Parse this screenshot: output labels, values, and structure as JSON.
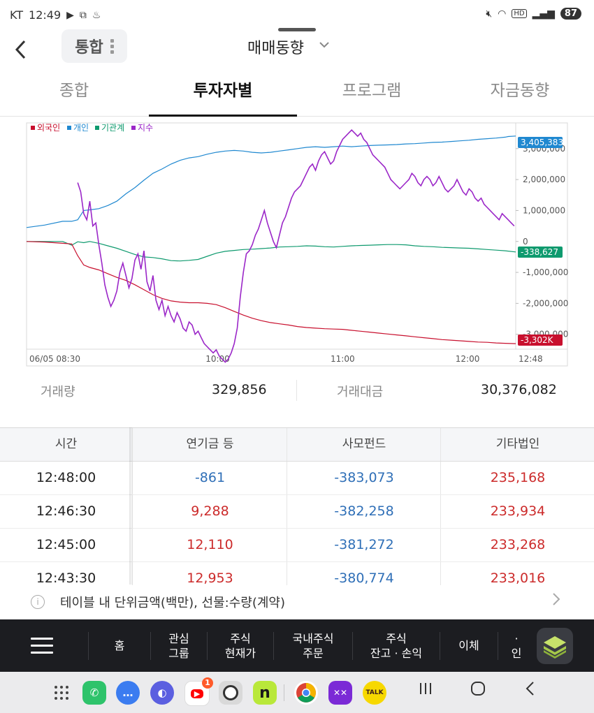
{
  "status_bar": {
    "carrier": "KT",
    "time": "12:49",
    "battery": "87"
  },
  "app_bar": {
    "pill_label": "통합",
    "title": "매매동향"
  },
  "tabs": [
    {
      "label": "종합",
      "active": false
    },
    {
      "label": "투자자별",
      "active": true
    },
    {
      "label": "프로그램",
      "active": false
    },
    {
      "label": "자금동향",
      "active": false
    }
  ],
  "chart_data": {
    "type": "line",
    "legend": [
      "외국인",
      "개인",
      "기관계",
      "지수"
    ],
    "colors": {
      "foreign": "#c8102e",
      "individual": "#1f88d0",
      "institution": "#0e9a6e",
      "index": "#9b27c8"
    },
    "y_tick_labels": [
      "3,000,000",
      "2,000,000",
      "1,000,000",
      "0",
      "-1,000,000",
      "-2,000,000",
      "-3,000,000"
    ],
    "y_ticks": [
      3000000,
      2000000,
      1000000,
      0,
      -1000000,
      -2000000,
      -3000000
    ],
    "x_tick_labels": [
      "06/05 08:30",
      "10:00",
      "11:00",
      "12:00",
      "12:48"
    ],
    "ylim": [
      -3480000,
      3830000
    ],
    "end_labels": {
      "individual": "3,405,383",
      "institution": "-338,627",
      "foreign": "-3,302K"
    },
    "series": [
      {
        "name": "개인",
        "key": "individual",
        "x": [
          0,
          12,
          24,
          30,
          34,
          38,
          42,
          48,
          54,
          60,
          66,
          72,
          78,
          84,
          90,
          96,
          102,
          108,
          114,
          120,
          126,
          132,
          138,
          144,
          150,
          156,
          162,
          168,
          174,
          180,
          186,
          192,
          198,
          204,
          210,
          216,
          222,
          228,
          234,
          240,
          246,
          252,
          258,
          264,
          270,
          276,
          282,
          288,
          294,
          300,
          306,
          312,
          318,
          320,
          325
        ],
        "y": [
          450000,
          530000,
          650000,
          650000,
          700000,
          1000000,
          1020000,
          1060000,
          1160000,
          1300000,
          1540000,
          1740000,
          1980000,
          2200000,
          2340000,
          2500000,
          2620000,
          2700000,
          2740000,
          2820000,
          2880000,
          2920000,
          2940000,
          2920000,
          2880000,
          2860000,
          2880000,
          2920000,
          2960000,
          3000000,
          3040000,
          3060000,
          3040000,
          3060000,
          3080000,
          3060000,
          3080000,
          3100000,
          3110000,
          3120000,
          3130000,
          3150000,
          3160000,
          3180000,
          3200000,
          3210000,
          3230000,
          3250000,
          3270000,
          3300000,
          3320000,
          3340000,
          3370000,
          3390000,
          3405383
        ]
      },
      {
        "name": "기관계",
        "key": "institution",
        "x": [
          0,
          12,
          24,
          30,
          34,
          38,
          42,
          48,
          54,
          60,
          66,
          72,
          78,
          84,
          90,
          96,
          102,
          108,
          114,
          120,
          126,
          132,
          138,
          144,
          150,
          156,
          162,
          168,
          174,
          180,
          186,
          192,
          198,
          204,
          210,
          216,
          222,
          228,
          234,
          240,
          246,
          252,
          258,
          264,
          270,
          276,
          282,
          288,
          294,
          300,
          306,
          312,
          318,
          325
        ],
        "y": [
          0,
          0,
          0,
          -120000,
          -10000,
          -40000,
          0,
          -60000,
          -140000,
          -220000,
          -320000,
          -420000,
          -500000,
          -520000,
          -560000,
          -620000,
          -630000,
          -610000,
          -580000,
          -480000,
          -380000,
          -320000,
          -290000,
          -260000,
          -250000,
          -230000,
          -210000,
          -180000,
          -170000,
          -160000,
          -140000,
          -150000,
          -170000,
          -180000,
          -160000,
          -140000,
          -130000,
          -120000,
          -110000,
          -100000,
          -100000,
          -110000,
          -140000,
          -160000,
          -170000,
          -190000,
          -200000,
          -210000,
          -220000,
          -240000,
          -260000,
          -280000,
          -300000,
          -338627
        ]
      },
      {
        "name": "외국인",
        "key": "foreign",
        "x": [
          0,
          12,
          24,
          30,
          34,
          38,
          42,
          48,
          54,
          60,
          66,
          72,
          78,
          84,
          90,
          96,
          102,
          108,
          114,
          120,
          126,
          132,
          138,
          144,
          150,
          156,
          162,
          168,
          174,
          180,
          186,
          192,
          198,
          204,
          210,
          216,
          222,
          228,
          234,
          240,
          246,
          252,
          258,
          264,
          270,
          276,
          282,
          288,
          294,
          300,
          306,
          312,
          318,
          325
        ],
        "y": [
          0,
          -20000,
          -60000,
          -80000,
          -460000,
          -760000,
          -840000,
          -920000,
          -1040000,
          -1160000,
          -1260000,
          -1400000,
          -1560000,
          -1720000,
          -1840000,
          -1920000,
          -1960000,
          -1980000,
          -1980000,
          -2000000,
          -2040000,
          -2140000,
          -2260000,
          -2380000,
          -2480000,
          -2560000,
          -2620000,
          -2660000,
          -2700000,
          -2750000,
          -2780000,
          -2800000,
          -2820000,
          -2830000,
          -2840000,
          -2870000,
          -2900000,
          -2930000,
          -2960000,
          -2990000,
          -3020000,
          -3050000,
          -3080000,
          -3110000,
          -3140000,
          -3170000,
          -3190000,
          -3210000,
          -3230000,
          -3250000,
          -3260000,
          -3280000,
          -3290000,
          -3302000
        ]
      },
      {
        "name": "지수",
        "key": "index",
        "x": [
          34,
          36,
          38,
          40,
          42,
          44,
          46,
          48,
          50,
          52,
          54,
          56,
          58,
          60,
          62,
          64,
          66,
          68,
          70,
          72,
          74,
          76,
          78,
          80,
          82,
          84,
          86,
          88,
          90,
          92,
          94,
          96,
          98,
          100,
          102,
          104,
          106,
          108,
          110,
          112,
          114,
          116,
          118,
          120,
          122,
          124,
          126,
          128,
          130,
          132,
          134,
          136,
          138,
          140,
          142,
          144,
          146,
          148,
          150,
          152,
          154,
          156,
          158,
          160,
          162,
          164,
          166,
          168,
          170,
          172,
          174,
          176,
          178,
          180,
          182,
          184,
          186,
          188,
          190,
          192,
          194,
          196,
          198,
          200,
          202,
          204,
          206,
          208,
          210,
          212,
          214,
          216,
          218,
          220,
          222,
          224,
          226,
          228,
          230,
          232,
          234,
          236,
          238,
          240,
          242,
          244,
          246,
          248,
          250,
          252,
          254,
          256,
          258,
          260,
          262,
          264,
          266,
          268,
          270,
          272,
          274,
          276,
          278,
          280,
          282,
          284,
          286,
          288,
          290,
          292,
          294,
          296,
          298,
          300,
          302,
          304,
          306,
          308,
          310,
          312,
          314,
          316,
          318,
          320,
          322,
          324
        ],
        "y": [
          1900000,
          1600000,
          900000,
          700000,
          1300000,
          500000,
          600000,
          -100000,
          -700000,
          -1400000,
          -1800000,
          -2100000,
          -1900000,
          -1600000,
          -1000000,
          -700000,
          -1100000,
          -1500000,
          -1200000,
          -600000,
          -400000,
          -900000,
          -300000,
          -1300000,
          -1600000,
          -1100000,
          -1900000,
          -2200000,
          -1900000,
          -2400000,
          -2100000,
          -2400000,
          -2600000,
          -2300000,
          -2500000,
          -2800000,
          -2900000,
          -2600000,
          -2700000,
          -3000000,
          -2900000,
          -3100000,
          -3300000,
          -3400000,
          -3500000,
          -3600000,
          -3500000,
          -3700000,
          -3800000,
          -3900000,
          -3800000,
          -3600000,
          -3300000,
          -2800000,
          -1800000,
          -1000000,
          -400000,
          -300000,
          -100000,
          200000,
          400000,
          700000,
          1000000,
          600000,
          300000,
          0,
          -200000,
          200000,
          600000,
          800000,
          1100000,
          1400000,
          1600000,
          1700000,
          1800000,
          2000000,
          2200000,
          2400000,
          2500000,
          2300000,
          2600000,
          2800000,
          2900000,
          2700000,
          2500000,
          2600000,
          2900000,
          3100000,
          3300000,
          3400000,
          3500000,
          3600000,
          3500000,
          3400000,
          3500000,
          3300000,
          3200000,
          3000000,
          2800000,
          2700000,
          2600000,
          2500000,
          2400000,
          2200000,
          2000000,
          1900000,
          1800000,
          1700000,
          1800000,
          1900000,
          2000000,
          2200000,
          2100000,
          1900000,
          1800000,
          2000000,
          2100000,
          2000000,
          1800000,
          1900000,
          2100000,
          1900000,
          1700000,
          1600000,
          1700000,
          1800000,
          2000000,
          1800000,
          1600000,
          1500000,
          1700000,
          1600000,
          1400000,
          1300000,
          1400000,
          1200000,
          1100000,
          1000000,
          900000,
          800000,
          700000,
          900000,
          800000,
          700000,
          600000,
          500000
        ]
      }
    ]
  },
  "summary": {
    "volume_label": "거래량",
    "volume_value": "329,856",
    "amount_label": "거래대금",
    "amount_value": "30,376,082"
  },
  "table": {
    "headers": [
      "시간",
      "연기금 등",
      "사모펀드",
      "기타법인"
    ],
    "rows": [
      {
        "time": "12:48:00",
        "pension": "-861",
        "pension_sign": "neg",
        "pef": "-383,073",
        "pef_sign": "neg",
        "corp": "235,168",
        "corp_sign": "pos"
      },
      {
        "time": "12:46:30",
        "pension": "9,288",
        "pension_sign": "pos",
        "pef": "-382,258",
        "pef_sign": "neg",
        "corp": "233,934",
        "corp_sign": "pos"
      },
      {
        "time": "12:45:00",
        "pension": "12,110",
        "pension_sign": "pos",
        "pef": "-381,272",
        "pef_sign": "neg",
        "corp": "233,268",
        "corp_sign": "pos"
      },
      {
        "time": "12:43:30",
        "pension": "12,953",
        "pension_sign": "pos",
        "pef": "-380,774",
        "pef_sign": "neg",
        "corp": "233,016",
        "corp_sign": "pos"
      }
    ]
  },
  "note": {
    "text": "테이블 내 단위금액(백만), 선물:수량(계약)"
  },
  "bottom_menu": [
    {
      "line1": "홈",
      "line2": ""
    },
    {
      "line1": "관심",
      "line2": "그룹"
    },
    {
      "line1": "주식",
      "line2": "현재가"
    },
    {
      "line1": "국내주식",
      "line2": "주문"
    },
    {
      "line1": "주식",
      "line2": "잔고 · 손익"
    },
    {
      "line1": "이체",
      "line2": ""
    },
    {
      "line1": "·",
      "line2": "인"
    }
  ],
  "dock_badge": "1",
  "dock_apps": [
    "phone-icon",
    "messages-icon",
    "internet-icon",
    "youtube-icon",
    "camera-icon",
    "naver-icon",
    "chrome-icon",
    "apps-icon",
    "kakaotalk-icon"
  ],
  "kakao_label": "TALK",
  "naver_label": "n"
}
